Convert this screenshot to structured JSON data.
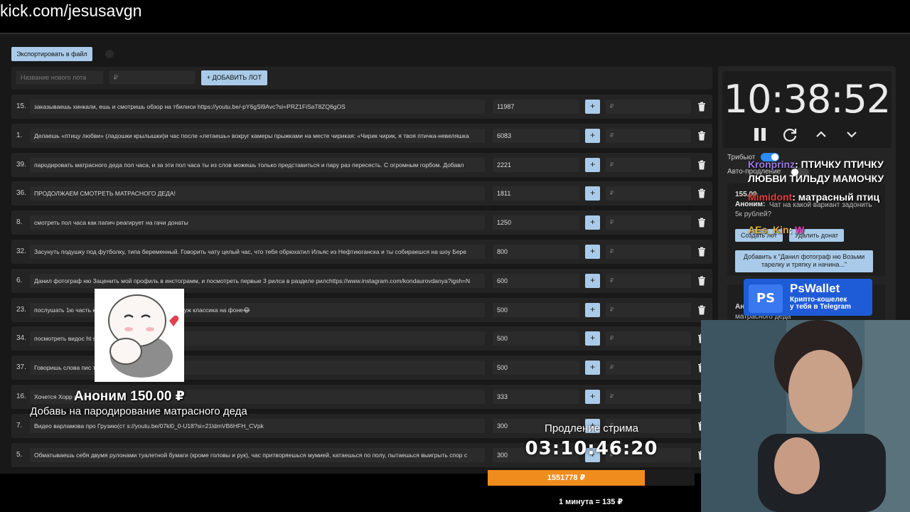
{
  "browser": {
    "url": "kick.com/jesusavgn"
  },
  "toolbar": {
    "export_label": "Экспортировать в файл"
  },
  "lot_form": {
    "name_placeholder": "Название нового лота",
    "amount_placeholder": "₽",
    "add_label": "+ ДОБАВИТЬ ЛОТ"
  },
  "lots": [
    {
      "num": "15.",
      "text": "заказываешь хинкали, ешь и смотришь обзор на тбилиси https://youtu.be/-pY6gSl9Avc?si=PRZ1FiSaT8ZQ6gOS",
      "amount": "11987",
      "plus": "+",
      "rub": "₽"
    },
    {
      "num": "1.",
      "text": "Делаешь «птицу любви» (ладошки крылышки)и час после «летаешь» вокруг камеры прыжками на месте чирикая: «Чирик чирик, я твоя птичка-невеляшка",
      "amount": "6083",
      "plus": "+",
      "rub": "₽"
    },
    {
      "num": "39.",
      "text": "пародировать матрасного деда пол часа, и за эти пол часа ты из слов можешь только представиться и пару раз пересесть. С огромным горбом. Добавл",
      "amount": "2221",
      "plus": "+",
      "rub": "₽"
    },
    {
      "num": "36.",
      "text": "ПРОДОЛЖАЕМ СМОТРЕТЬ МАТРАСНОГО ДЕДА!",
      "amount": "1811",
      "plus": "+",
      "rub": "₽"
    },
    {
      "num": "8.",
      "text": "смотреть пол часа как папич реагирует на гачи донаты",
      "amount": "1250",
      "plus": "+",
      "rub": "₽"
    },
    {
      "num": "32.",
      "text": "Засунуть подушку под футболку, типа беременный. Говорить чату целый час, что тебя обрюхатил Ильяс из Нефтиюганска и ты собираешся на шоу Бере",
      "amount": "800",
      "plus": "+",
      "rub": "₽"
    },
    {
      "num": "6.",
      "text": "Данил фотограф ню Заценить мой профиль в инстограмм, и посмотреть первые 3 рилса в разделе рилсhttps://www.instagram.com/kondaurovdanya?igsh=N",
      "amount": "600",
      "plus": "+",
      "rub": "₽"
    },
    {
      "num": "23.",
      "text": "послушать 1ю часть                                        ке чутка пообразовываемся раз уж классика на фоне😂",
      "amount": "500",
      "plus": "+",
      "rub": "₽"
    },
    {
      "num": "34.",
      "text": "посмотреть видос ht                                 si=Mgh7nStvRQKbwwxp",
      "amount": "500",
      "plus": "+",
      "rub": "₽"
    },
    {
      "num": "37.",
      "text": "Говоришь слова пис                                    т",
      "amount": "500",
      "plus": "+",
      "rub": "₽"
    },
    {
      "num": "16.",
      "text": "Хочется Хорр                                            r Game",
      "amount": "333",
      "plus": "+",
      "rub": "₽"
    },
    {
      "num": "7.",
      "text": "Видео варламова про Грузию(ст              s://youtu.be/07kl0_0-U18?si=21ldmVB6HFH_CVpk",
      "amount": "300",
      "plus": "+",
      "rub": "₽"
    },
    {
      "num": "5.",
      "text": "Обматываешь себя двумя рулонами туалетной бумаги (кроме головы и рук), час притворяешься мумией, катаешься по полу, пытаешься выигрыть спор с",
      "amount": "300",
      "plus": "+",
      "rub": "₽"
    }
  ],
  "timer": {
    "value": "10:38:52"
  },
  "settings": {
    "tribute_label": "Трибьют",
    "tribute_on": true,
    "autoext_label": "Авто-продление",
    "autoext_on": false
  },
  "donation": {
    "amount": "155.00",
    "author": "Аноним:",
    "message": "Чат на какой вариант задонить 5к рублей?",
    "create_lot": "Создать лот",
    "delete": "Удалить донат",
    "add_to": "Добавить к \"Данил фотограф ню Возьми тарелку и тряпку и начина...\""
  },
  "donation2": {
    "prefix": "Ан",
    "text": "матрасного деда"
  },
  "chat": [
    {
      "user": "Kronprinz",
      "text": ": ПТИЧКУ ПТИЧКУ"
    },
    {
      "user": "",
      "text": "ЛЮБВИ ТИЛЬДУ МАМОЧКУ"
    },
    {
      "user": "Mimidont",
      "text": ": матрасный птиц"
    },
    {
      "user": "AEs_Kin",
      "text": ":",
      "emote": "W"
    }
  ],
  "ad": {
    "title": "PsWallet",
    "logo": "PS",
    "sub1": "Крипто-кошелек",
    "sub2": "у тебя в Telegram"
  },
  "alert": {
    "name": "Аноним  150.00 ₽",
    "message": "Добавь на пародирование матрасного деда"
  },
  "extension": {
    "label": "Продление стрима",
    "timer": "03:10:46:20"
  },
  "goal": {
    "amount_label": "1551778 ₽",
    "progress": 0.76,
    "rate": "1 минута = 135 ₽"
  },
  "colors": {
    "accent": "#a9cbe9",
    "progress": "#f08c1e",
    "toggle_on": "#2d8cff"
  }
}
